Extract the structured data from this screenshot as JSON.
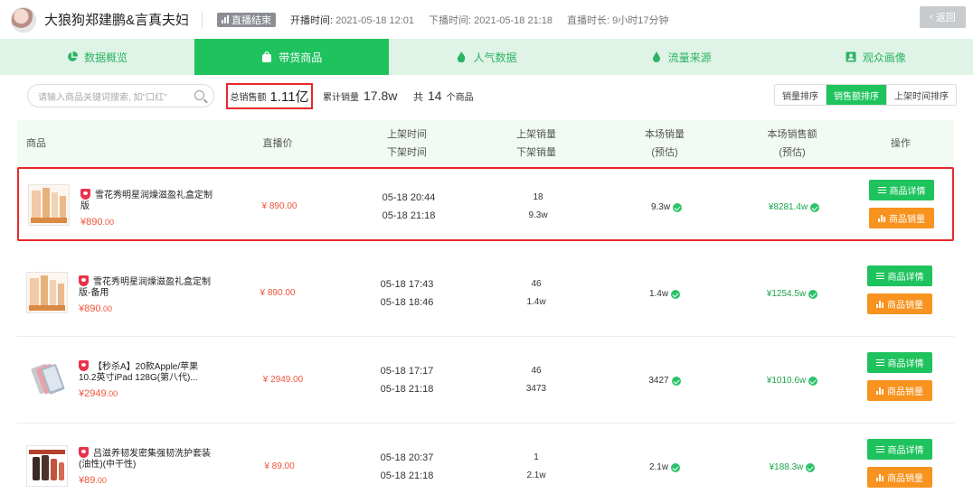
{
  "header": {
    "anchor_name": "大狼狗郑建鹏&言真夫妇",
    "live_status": "直播结束",
    "start_label": "开播时间:",
    "start_value": "2021-05-18 12:01",
    "end_label": "下播时间:",
    "end_value": "2021-05-18 21:18",
    "duration_label": "直播时长:",
    "duration_value": "9小时17分钟",
    "back_label": "返回"
  },
  "tabs": [
    {
      "label": "数据概览",
      "icon": "pie-chart-icon",
      "active": false
    },
    {
      "label": "带货商品",
      "icon": "shopping-bag-icon",
      "active": true
    },
    {
      "label": "人气数据",
      "icon": "flame-icon",
      "active": false
    },
    {
      "label": "流量来源",
      "icon": "droplet-icon",
      "active": false
    },
    {
      "label": "观众画像",
      "icon": "profile-card-icon",
      "active": false
    }
  ],
  "filter": {
    "search_placeholder": "请输入商品关键词搜索, 如\"口红\"",
    "total_sales_label": "总销售额",
    "total_sales_value": "1.11亿",
    "cumulative_label": "累计销量",
    "cumulative_value": "17.8w",
    "count_prefix": "共",
    "count_value": "14",
    "count_suffix": "个商品",
    "sort_options": [
      "销量排序",
      "销售额排序",
      "上架时间排序"
    ],
    "sort_active": "销售额排序"
  },
  "table": {
    "headers": {
      "product": "商品",
      "live_price": "直播价",
      "on_time": "上架时间",
      "off_time": "下架时间",
      "on_sales": "上架销量",
      "off_sales": "下架销量",
      "session_sales": "本场销量",
      "session_sales_sub": "(预估)",
      "session_amount": "本场销售额",
      "session_amount_sub": "(预估)",
      "action": "操作"
    },
    "detail_label": "商品详情",
    "sales_label": "商品销量",
    "rows": [
      {
        "title": "雪花秀明星润燥滋盈礼盒定制版",
        "price_main": "¥890",
        "price_dec": ".00",
        "live_price": "¥ 890.00",
        "on_time": "05-18 20:44",
        "off_time": "05-18 21:18",
        "on_sales": "18",
        "off_sales": "9.3w",
        "session_sales": "9.3w",
        "session_amount": "¥8281.4w",
        "image": "cosmetics-set"
      },
      {
        "title": "雪花秀明星润燥滋盈礼盒定制版-备用",
        "price_main": "¥890",
        "price_dec": ".00",
        "live_price": "¥ 890.00",
        "on_time": "05-18 17:43",
        "off_time": "05-18 18:46",
        "on_sales": "46",
        "off_sales": "1.4w",
        "session_sales": "1.4w",
        "session_amount": "¥1254.5w",
        "image": "cosmetics-set"
      },
      {
        "title": "【秒杀A】20款Apple/苹果 10.2英寸iPad 128G(第八代)...",
        "price_main": "¥2949",
        "price_dec": ".00",
        "live_price": "¥ 2949.00",
        "on_time": "05-18 17:17",
        "off_time": "05-18 21:18",
        "on_sales": "46",
        "off_sales": "3473",
        "session_sales": "3427",
        "session_amount": "¥1010.6w",
        "image": "tablets"
      },
      {
        "title": "吕滋养韧发密集强韧洗护套装(油性)(中干性)",
        "price_main": "¥89",
        "price_dec": ".00",
        "live_price": "¥ 89.00",
        "on_time": "05-18 20:37",
        "off_time": "05-18 21:18",
        "on_sales": "1",
        "off_sales": "2.1w",
        "session_sales": "2.1w",
        "session_amount": "¥188.3w",
        "image": "shampoo-set"
      }
    ]
  }
}
